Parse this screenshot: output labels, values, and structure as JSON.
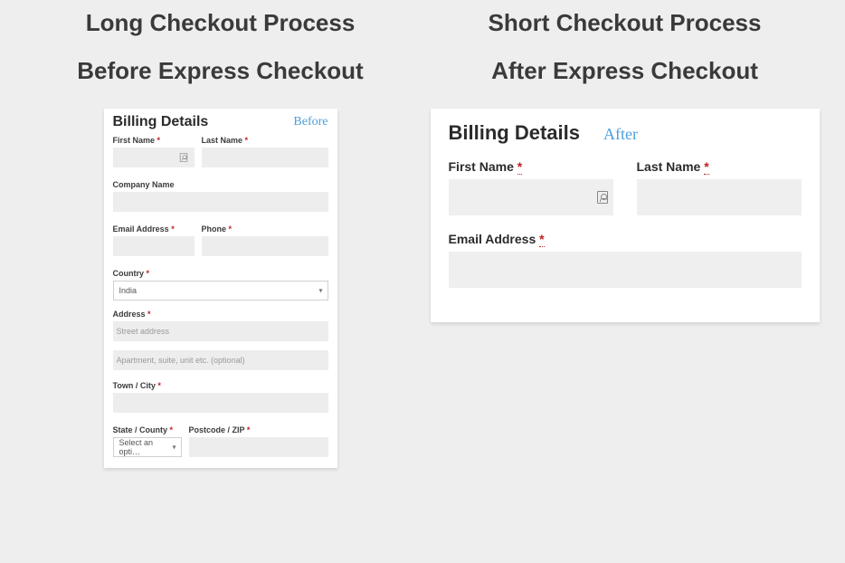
{
  "left": {
    "heading1": "Long Checkout Process",
    "heading2": "Before Express Checkout",
    "panel": {
      "title": "Billing Details",
      "badge": "Before",
      "first_name": "First Name",
      "last_name": "Last Name",
      "company": "Company Name",
      "email": "Email Address",
      "phone": "Phone",
      "country": "Country",
      "country_value": "India",
      "address": "Address",
      "address_ph1": "Street address",
      "address_ph2": "Apartment, suite, unit etc. (optional)",
      "town": "Town / City",
      "state": "State / County",
      "state_value": "Select an opti…",
      "postcode": "Postcode / ZIP",
      "star": "*"
    }
  },
  "right": {
    "heading1": "Short Checkout Process",
    "heading2": "After Express Checkout",
    "panel": {
      "title": "Billing Details",
      "badge": "After",
      "first_name": "First Name",
      "last_name": "Last Name",
      "email": "Email Address",
      "star": "*"
    }
  }
}
